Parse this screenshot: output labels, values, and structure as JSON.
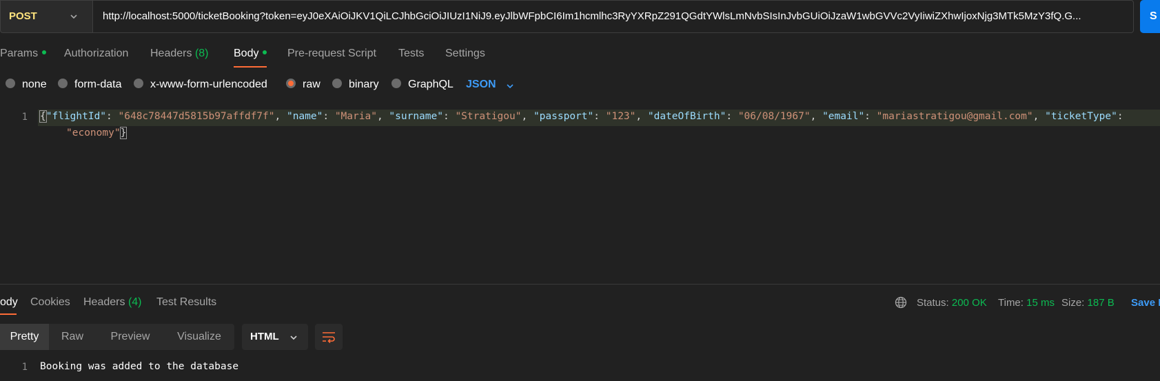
{
  "request": {
    "method": "POST",
    "url": "http://localhost:5000/ticketBooking?token=eyJ0eXAiOiJKV1QiLCJhbGciOiJIUzI1NiJ9.eyJlbWFpbCI6Im1hcmlhc3RyYXRpZ291QGdtYWlsLmNvbSIsInJvbGUiOiJzaW1wbGVVc2VyIiwiZXhwIjoxNjg3MTk5MzY3fQ.G...",
    "send_label": "S"
  },
  "request_tabs": [
    {
      "label": "Params",
      "dot": true
    },
    {
      "label": "Authorization"
    },
    {
      "label": "Headers",
      "count": "(8)"
    },
    {
      "label": "Body",
      "dot": true,
      "active": true
    },
    {
      "label": "Pre-request Script"
    },
    {
      "label": "Tests"
    },
    {
      "label": "Settings"
    }
  ],
  "body_types": [
    {
      "label": "none"
    },
    {
      "label": "form-data"
    },
    {
      "label": "x-www-form-urlencoded"
    },
    {
      "label": "raw",
      "selected": true
    },
    {
      "label": "binary"
    },
    {
      "label": "GraphQL"
    }
  ],
  "body_format": "JSON",
  "editor": {
    "line_number": "1",
    "tokens": {
      "k_flightId": "\"flightId\"",
      "v_flightId": "\"648c78447d5815b97affdf7f\"",
      "k_name": "\"name\"",
      "v_name": "\"Maria\"",
      "k_surname": "\"surname\"",
      "v_surname": "\"Stratigou\"",
      "k_passport": "\"passport\"",
      "v_passport": "\"123\"",
      "k_dateOfBirth": "\"dateOfBirth\"",
      "v_dateOfBirth": "\"06/08/1967\"",
      "k_email": "\"email\"",
      "v_email": "\"mariastratigou@gmail.com\"",
      "k_ticketType": "\"ticketType\"",
      "v_ticketType": "\"economy\""
    }
  },
  "response_tabs": [
    {
      "label": "ody",
      "active": true
    },
    {
      "label": "Cookies"
    },
    {
      "label": "Headers",
      "count": "(4)"
    },
    {
      "label": "Test Results"
    }
  ],
  "response_meta": {
    "status_label": "Status:",
    "status_value": "200 OK",
    "time_label": "Time:",
    "time_value": "15 ms",
    "size_label": "Size:",
    "size_value": "187 B",
    "save_label": "Save R"
  },
  "view_modes": [
    {
      "label": "Pretty",
      "active": true
    },
    {
      "label": "Raw"
    },
    {
      "label": "Preview"
    },
    {
      "label": "Visualize"
    }
  ],
  "response_language": "HTML",
  "response_body": {
    "line_number": "1",
    "text": "Booking was added to the database"
  },
  "colors": {
    "accent_orange": "#ff6c37",
    "method_yellow": "#ffe47e",
    "success_green": "#0cbb52",
    "link_blue": "#3d9bf7",
    "send_blue": "#097bed"
  },
  "icons": [
    "chevron-down-icon",
    "globe-icon",
    "wrap-lines-icon"
  ]
}
